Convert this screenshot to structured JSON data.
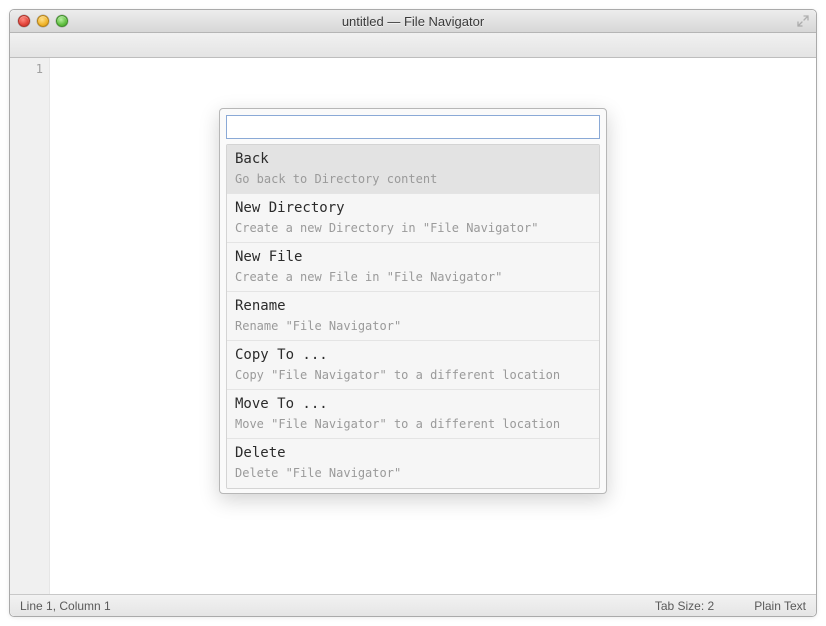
{
  "window": {
    "title": "untitled — File Navigator"
  },
  "gutter": {
    "line1": "1"
  },
  "palette": {
    "input_value": "",
    "input_placeholder": "",
    "items": [
      {
        "title": "Back",
        "desc": "Go back to Directory content",
        "selected": true
      },
      {
        "title": "New Directory",
        "desc": "Create a new Directory in \"File Navigator\"",
        "selected": false
      },
      {
        "title": "New File",
        "desc": "Create a new File in \"File Navigator\"",
        "selected": false
      },
      {
        "title": "Rename",
        "desc": "Rename \"File Navigator\"",
        "selected": false
      },
      {
        "title": "Copy To ...",
        "desc": "Copy \"File Navigator\" to a different location",
        "selected": false
      },
      {
        "title": "Move To ...",
        "desc": "Move \"File Navigator\" to a different location",
        "selected": false
      },
      {
        "title": "Delete",
        "desc": "Delete \"File Navigator\"",
        "selected": false
      }
    ]
  },
  "statusbar": {
    "position": "Line 1, Column 1",
    "tab_size": "Tab Size: 2",
    "syntax": "Plain Text"
  }
}
